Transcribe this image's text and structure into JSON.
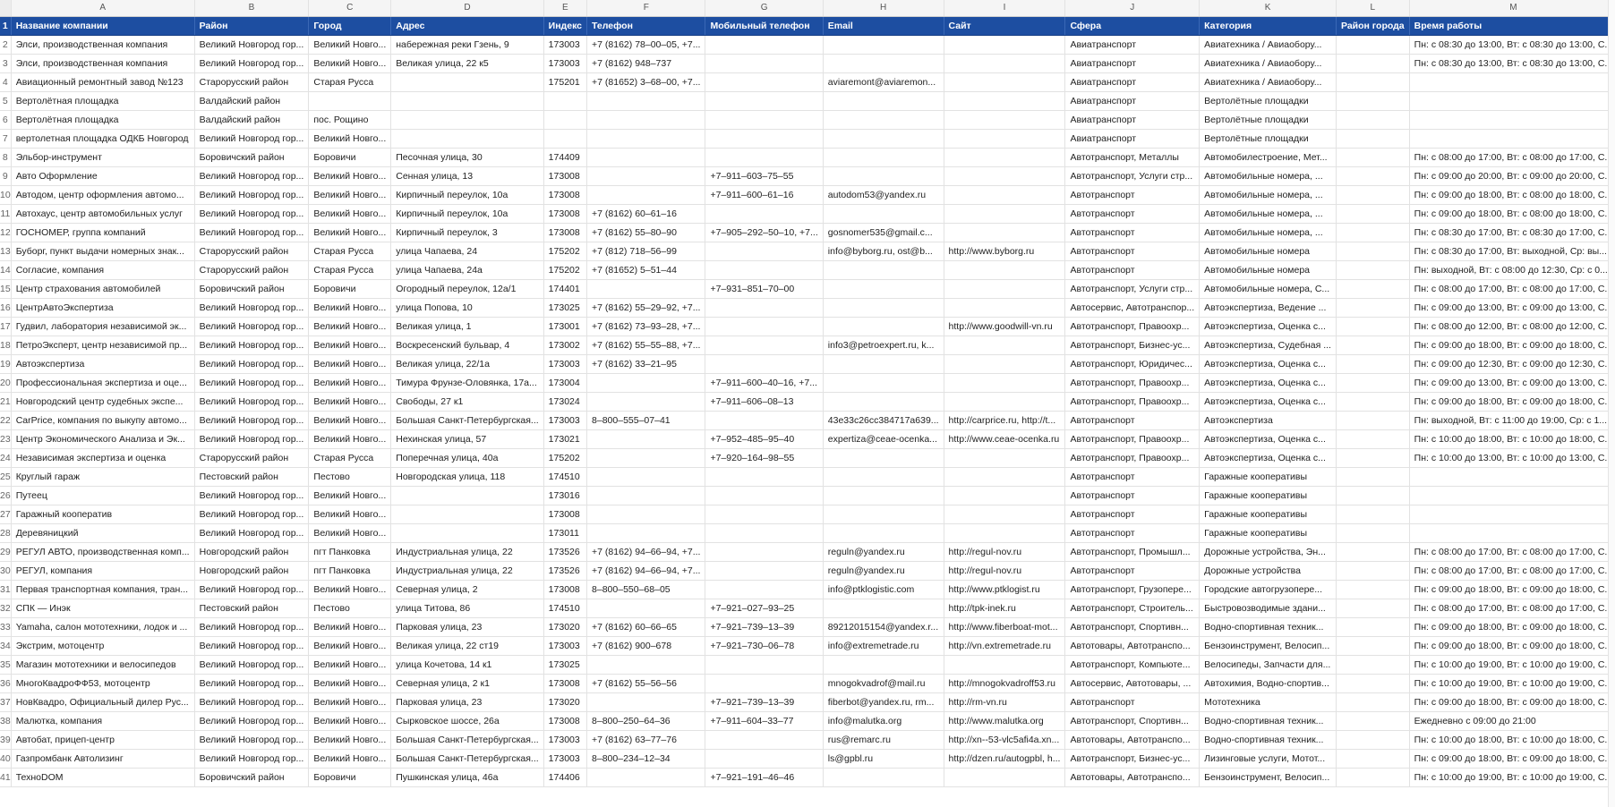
{
  "columns": [
    "A",
    "B",
    "C",
    "D",
    "E",
    "F",
    "G",
    "H",
    "I",
    "J",
    "K",
    "L",
    "M"
  ],
  "header_row_number": "1",
  "headers": [
    "Название компании",
    "Район",
    "Город",
    "Адрес",
    "Индекс",
    "Телефон",
    "Мобильный телефон",
    "Email",
    "Сайт",
    "Сфера",
    "Категория",
    "Район города",
    "Время работы"
  ],
  "rows": [
    [
      "2",
      "Элси, производственная компания",
      "Великий Новгород гор...",
      "Великий Новго...",
      "набережная реки Гзень, 9",
      "173003",
      "+7 (8162) 78–00–05, +7...",
      "",
      "",
      "",
      "Авиатранспорт",
      "Авиатехника / Авиаобору...",
      "",
      "Пн: с 08:30 до 13:00, Вт: с 08:30 до 13:00, С..."
    ],
    [
      "3",
      "Элси, производственная компания",
      "Великий Новгород гор...",
      "Великий Новго...",
      "Великая улица, 22 к5",
      "173003",
      "+7 (8162) 948–737",
      "",
      "",
      "",
      "Авиатранспорт",
      "Авиатехника / Авиаобору...",
      "",
      "Пн: с 08:30 до 13:00, Вт: с 08:30 до 13:00, С..."
    ],
    [
      "4",
      "Авиационный ремонтный завод №123",
      "Старорусский район",
      "Старая Русса",
      "",
      "175201",
      "+7 (81652) 3–68–00, +7...",
      "",
      "aviaremont@aviaremon...",
      "",
      "Авиатранспорт",
      "Авиатехника / Авиаобору...",
      "",
      ""
    ],
    [
      "5",
      "Вертолётная площадка",
      "Валдайский район",
      "",
      "",
      "",
      "",
      "",
      "",
      "",
      "Авиатранспорт",
      "Вертолётные площадки",
      "",
      ""
    ],
    [
      "6",
      "Вертолётная площадка",
      "Валдайский район",
      "пос. Рощино",
      "",
      "",
      "",
      "",
      "",
      "",
      "Авиатранспорт",
      "Вертолётные площадки",
      "",
      ""
    ],
    [
      "7",
      "вертолетная площадка ОДКБ Новгород",
      "Великий Новгород гор...",
      "Великий Новго...",
      "",
      "",
      "",
      "",
      "",
      "",
      "Авиатранспорт",
      "Вертолётные площадки",
      "",
      ""
    ],
    [
      "8",
      "Эльбор-инструмент",
      "Боровичский район",
      "Боровичи",
      "Песочная улица, 30",
      "174409",
      "",
      "",
      "",
      "",
      "Автотранспорт, Металлы",
      "Автомобилестроение, Мет...",
      "",
      "Пн: с 08:00 до 17:00, Вт: с 08:00 до 17:00, С..."
    ],
    [
      "9",
      "Авто Оформление",
      "Великий Новгород гор...",
      "Великий Новго...",
      "Сенная улица, 13",
      "173008",
      "",
      "+7–911–603–75–55",
      "",
      "",
      "Автотранспорт, Услуги стр...",
      "Автомобильные номера, ...",
      "",
      "Пн: с 09:00 до 20:00, Вт: с 09:00 до 20:00, С..."
    ],
    [
      "10",
      "Автодом, центр оформления автомо...",
      "Великий Новгород гор...",
      "Великий Новго...",
      "Кирпичный переулок, 10а",
      "173008",
      "",
      "+7–911–600–61–16",
      "autodom53@yandex.ru",
      "",
      "Автотранспорт",
      "Автомобильные номера, ...",
      "",
      "Пн: с 09:00 до 18:00, Вт: с 08:00 до 18:00, С..."
    ],
    [
      "11",
      "Автохаус, центр автомобильных услуг",
      "Великий Новгород гор...",
      "Великий Новго...",
      "Кирпичный переулок, 10а",
      "173008",
      "+7 (8162) 60–61–16",
      "",
      "",
      "",
      "Автотранспорт",
      "Автомобильные номера, ...",
      "",
      "Пн: с 09:00 до 18:00, Вт: с 08:00 до 18:00, С..."
    ],
    [
      "12",
      "ГОСНОМЕР, группа компаний",
      "Великий Новгород гор...",
      "Великий Новго...",
      "Кирпичный переулок, 3",
      "173008",
      "+7 (8162) 55–80–90",
      "+7–905–292–50–10, +7...",
      "gosnomer535@gmail.c...",
      "",
      "Автотранспорт",
      "Автомобильные номера, ...",
      "",
      "Пн: с 08:30 до 17:00, Вт: с 08:30 до 17:00, С..."
    ],
    [
      "13",
      "Буборг, пункт выдачи номерных знак...",
      "Старорусский район",
      "Старая Русса",
      "улица Чапаева, 24",
      "175202",
      "+7 (812) 718–56–99",
      "",
      "info@byborg.ru, ost@b...",
      "http://www.byborg.ru",
      "Автотранспорт",
      "Автомобильные номера",
      "",
      "Пн: с 08:30 до 17:00, Вт: выходной, Ср: вы..."
    ],
    [
      "14",
      "Согласие, компания",
      "Старорусский район",
      "Старая Русса",
      "улица Чапаева, 24а",
      "175202",
      "+7 (81652) 5–51–44",
      "",
      "",
      "",
      "Автотранспорт",
      "Автомобильные номера",
      "",
      "Пн: выходной, Вт: с 08:00 до 12:30, Ср: с 0..."
    ],
    [
      "15",
      "Центр страхования автомобилей",
      "Боровичский район",
      "Боровичи",
      "Огородный переулок, 12а/1",
      "174401",
      "",
      "+7–931–851–70–00",
      "",
      "",
      "Автотранспорт, Услуги стр...",
      "Автомобильные номера, С...",
      "",
      "Пн: с 08:00 до 17:00, Вт: с 08:00 до 17:00, С..."
    ],
    [
      "16",
      "ЦентрАвтоЭкспертиза",
      "Великий Новгород гор...",
      "Великий Новго...",
      "улица Попова, 10",
      "173025",
      "+7 (8162) 55–29–92, +7...",
      "",
      "",
      "",
      "Автосервис, Автотранспор...",
      "Автоэкспертиза, Ведение ...",
      "",
      "Пн: с 09:00 до 13:00, Вт: с 09:00 до 13:00, С..."
    ],
    [
      "17",
      "Гудвил, лаборатория независимой эк...",
      "Великий Новгород гор...",
      "Великий Новго...",
      "Великая улица, 1",
      "173001",
      "+7 (8162) 73–93–28, +7...",
      "",
      "",
      "http://www.goodwill-vn.ru",
      "Автотранспорт, Правоохр...",
      "Автоэкспертиза, Оценка с...",
      "",
      "Пн: с 08:00 до 12:00, Вт: с 08:00 до 12:00, С..."
    ],
    [
      "18",
      "ПетроЭксперт, центр независимой пр...",
      "Великий Новгород гор...",
      "Великий Новго...",
      "Воскресенский бульвар, 4",
      "173002",
      "+7 (8162) 55–55–88, +7...",
      "",
      "info3@petroexpert.ru, k...",
      "",
      "Автотранспорт, Бизнес-ус...",
      "Автоэкспертиза, Судебная ...",
      "",
      "Пн: с 09:00 до 18:00, Вт: с 09:00 до 18:00, С..."
    ],
    [
      "19",
      "Автоэкспертиза",
      "Великий Новгород гор...",
      "Великий Новго...",
      "Великая улица, 22/1а",
      "173003",
      "+7 (8162) 33–21–95",
      "",
      "",
      "",
      "Автотранспорт, Юридичес...",
      "Автоэкспертиза, Оценка с...",
      "",
      "Пн: с 09:00 до 12:30, Вт: с 09:00 до 12:30, С..."
    ],
    [
      "20",
      "Профессиональная экспертиза и оце...",
      "Великий Новгород гор...",
      "Великий Новго...",
      "Тимура Фрунзе-Оловянка, 17а...",
      "173004",
      "",
      "+7–911–600–40–16, +7...",
      "",
      "",
      "Автотранспорт, Правоохр...",
      "Автоэкспертиза, Оценка с...",
      "",
      "Пн: с 09:00 до 13:00, Вт: с 09:00 до 13:00, С..."
    ],
    [
      "21",
      "Новгородский центр судебных экспе...",
      "Великий Новгород гор...",
      "Великий Новго...",
      "Свободы, 27 к1",
      "173024",
      "",
      "+7–911–606–08–13",
      "",
      "",
      "Автотранспорт, Правоохр...",
      "Автоэкспертиза, Оценка с...",
      "",
      "Пн: с 09:00 до 18:00, Вт: с 09:00 до 18:00, С..."
    ],
    [
      "22",
      "CarPrice, компания по выкупу автомо...",
      "Великий Новгород гор...",
      "Великий Новго...",
      "Большая Санкт-Петербургская...",
      "173003",
      "8–800–555–07–41",
      "",
      "43e33c26cc384717a639...",
      "http://carprice.ru, http://t...",
      "Автотранспорт",
      "Автоэкспертиза",
      "",
      "Пн: выходной, Вт: с 11:00 до 19:00, Ср: с 1..."
    ],
    [
      "23",
      "Центр Экономического Анализа и Эк...",
      "Великий Новгород гор...",
      "Великий Новго...",
      "Нехинская улица, 57",
      "173021",
      "",
      "+7–952–485–95–40",
      "expertiza@ceae-ocenka...",
      "http://www.ceae-ocenka.ru",
      "Автотранспорт, Правоохр...",
      "Автоэкспертиза, Оценка с...",
      "",
      "Пн: с 10:00 до 18:00, Вт: с 10:00 до 18:00, С..."
    ],
    [
      "24",
      "Независимая экспертиза и оценка",
      "Старорусский район",
      "Старая Русса",
      "Поперечная улица, 40а",
      "175202",
      "",
      "+7–920–164–98–55",
      "",
      "",
      "Автотранспорт, Правоохр...",
      "Автоэкспертиза, Оценка с...",
      "",
      "Пн: с 10:00 до 13:00, Вт: с 10:00 до 13:00, С..."
    ],
    [
      "25",
      "Круглый гараж",
      "Пестовский район",
      "Пестово",
      "Новгородская улица, 118",
      "174510",
      "",
      "",
      "",
      "",
      "Автотранспорт",
      "Гаражные кооперативы",
      "",
      ""
    ],
    [
      "26",
      "Путеец",
      "Великий Новгород гор...",
      "Великий Новго...",
      "",
      "173016",
      "",
      "",
      "",
      "",
      "Автотранспорт",
      "Гаражные кооперативы",
      "",
      ""
    ],
    [
      "27",
      "Гаражный кооператив",
      "Великий Новгород гор...",
      "Великий Новго...",
      "",
      "173008",
      "",
      "",
      "",
      "",
      "Автотранспорт",
      "Гаражные кооперативы",
      "",
      ""
    ],
    [
      "28",
      "Деревяницкий",
      "Великий Новгород гор...",
      "Великий Новго...",
      "",
      "173011",
      "",
      "",
      "",
      "",
      "Автотранспорт",
      "Гаражные кооперативы",
      "",
      ""
    ],
    [
      "29",
      "РЕГУЛ АВТО, производственная комп...",
      "Новгородский район",
      "пгт Панковка",
      "Индустриальная улица, 22",
      "173526",
      "+7 (8162) 94–66–94, +7...",
      "",
      "reguln@yandex.ru",
      "http://regul-nov.ru",
      "Автотранспорт, Промышл...",
      "Дорожные устройства, Эн...",
      "",
      "Пн: с 08:00 до 17:00, Вт: с 08:00 до 17:00, С..."
    ],
    [
      "30",
      "РЕГУЛ, компания",
      "Новгородский район",
      "пгт Панковка",
      "Индустриальная улица, 22",
      "173526",
      "+7 (8162) 94–66–94, +7...",
      "",
      "reguln@yandex.ru",
      "http://regul-nov.ru",
      "Автотранспорт",
      "Дорожные устройства",
      "",
      "Пн: с 08:00 до 17:00, Вт: с 08:00 до 17:00, С..."
    ],
    [
      "31",
      "Первая транспортная компания, тран...",
      "Великий Новгород гор...",
      "Великий Новго...",
      "Северная улица, 2",
      "173008",
      "8–800–550–68–05",
      "",
      "info@ptklogistic.com",
      "http://www.ptklogist.ru",
      "Автотранспорт, Грузопере...",
      "Городские автогрузопере...",
      "",
      "Пн: с 09:00 до 18:00, Вт: с 09:00 до 18:00, С..."
    ],
    [
      "32",
      "СПК — Инэк",
      "Пестовский район",
      "Пестово",
      "улица Титова, 86",
      "174510",
      "",
      "+7–921–027–93–25",
      "",
      "http://tpk-inek.ru",
      "Автотранспорт, Строитель...",
      "Быстровозводимые здани...",
      "",
      "Пн: с 08:00 до 17:00, Вт: с 08:00 до 17:00, С..."
    ],
    [
      "33",
      "Yamaha, салон мототехники, лодок и ...",
      "Великий Новгород гор...",
      "Великий Новго...",
      "Парковая улица, 23",
      "173020",
      "+7 (8162) 60–66–65",
      "+7–921–739–13–39",
      "89212015154@yandex.r...",
      "http://www.fiberboat-mot...",
      "Автотранспорт, Спортивн...",
      "Водно-спортивная техник...",
      "",
      "Пн: с 09:00 до 18:00, Вт: с 09:00 до 18:00, С..."
    ],
    [
      "34",
      "Экстрим, мотоцентр",
      "Великий Новгород гор...",
      "Великий Новго...",
      "Великая улица, 22 ст19",
      "173003",
      "+7 (8162) 900–678",
      "+7–921–730–06–78",
      "info@extremetrade.ru",
      "http://vn.extremetrade.ru",
      "Автотовары, Автотранспо...",
      "Бензоинструмент, Велосип...",
      "",
      "Пн: с 09:00 до 18:00, Вт: с 09:00 до 18:00, С..."
    ],
    [
      "35",
      "Магазин мототехники и велосипедов",
      "Великий Новгород гор...",
      "Великий Новго...",
      "улица Кочетова, 14 к1",
      "173025",
      "",
      "",
      "",
      "",
      "Автотранспорт, Компьюте...",
      "Велосипеды, Запчасти для...",
      "",
      "Пн: с 10:00 до 19:00, Вт: с 10:00 до 19:00, С..."
    ],
    [
      "36",
      "МногоКвадроФФ53, мотоцентр",
      "Великий Новгород гор...",
      "Великий Новго...",
      "Северная улица, 2 к1",
      "173008",
      "+7 (8162) 55–56–56",
      "",
      "mnogokvadrof@mail.ru",
      "http://mnogokvadroff53.ru",
      "Автосервис, Автотовары, ...",
      "Автохимия, Водно-спортив...",
      "",
      "Пн: с 10:00 до 19:00, Вт: с 10:00 до 19:00, С..."
    ],
    [
      "37",
      "НовКвадро, Официальный дилер Рус...",
      "Великий Новгород гор...",
      "Великий Новго...",
      "Парковая улица, 23",
      "173020",
      "",
      "+7–921–739–13–39",
      "fiberbot@yandex.ru, rm...",
      "http://rm-vn.ru",
      "Автотранспорт",
      "Мототехника",
      "",
      "Пн: с 09:00 до 18:00, Вт: с 09:00 до 18:00, С..."
    ],
    [
      "38",
      "Малютка, компания",
      "Великий Новгород гор...",
      "Великий Новго...",
      "Сырковское шоссе, 26а",
      "173008",
      "8–800–250–64–36",
      "+7–911–604–33–77",
      "info@malutka.org",
      "http://www.malutka.org",
      "Автотранспорт, Спортивн...",
      "Водно-спортивная техник...",
      "",
      "Ежедневно с 09:00 до 21:00"
    ],
    [
      "39",
      "Автобат, прицеп-центр",
      "Великий Новгород гор...",
      "Великий Новго...",
      "Большая Санкт-Петербургская...",
      "173003",
      "+7 (8162) 63–77–76",
      "",
      "rus@remarc.ru",
      "http://xn--53-vlc5afi4a.xn...",
      "Автотовары, Автотранспо...",
      "Водно-спортивная техник...",
      "",
      "Пн: с 10:00 до 18:00, Вт: с 10:00 до 18:00, С..."
    ],
    [
      "40",
      "Газпромбанк Автолизинг",
      "Великий Новгород гор...",
      "Великий Новго...",
      "Большая Санкт-Петербургская...",
      "173003",
      "8–800–234–12–34",
      "",
      "ls@gpbl.ru",
      "http://dzen.ru/autogpbl, h...",
      "Автотранспорт, Бизнес-ус...",
      "Лизинговые услуги, Мотот...",
      "",
      "Пн: с 09:00 до 18:00, Вт: с 09:00 до 18:00, С..."
    ],
    [
      "41",
      "ТехноDOM",
      "Боровичский район",
      "Боровичи",
      "Пушкинская улица, 46а",
      "174406",
      "",
      "+7–921–191–46–46",
      "",
      "",
      "Автотовары, Автотранспо...",
      "Бензоинструмент, Велосип...",
      "",
      "Пн: с 10:00 до 19:00, Вт: с 10:00 до 19:00, С..."
    ]
  ]
}
